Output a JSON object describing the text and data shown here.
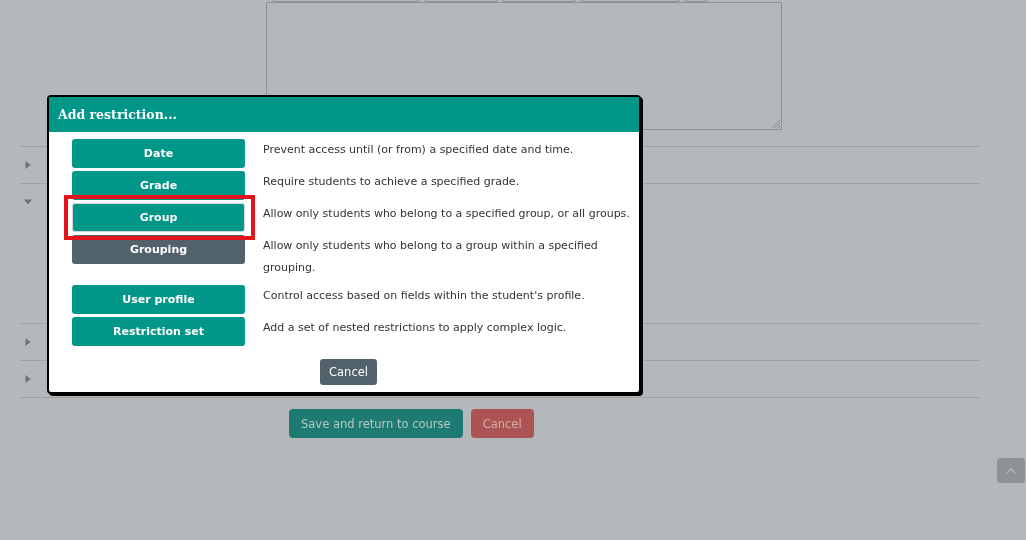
{
  "sections": [
    {
      "expanded": false
    },
    {
      "expanded": true
    },
    {
      "expanded": false
    },
    {
      "expanded": false
    }
  ],
  "form_buttons": [
    {
      "label": "Save and return to course",
      "kind": "primary"
    },
    {
      "label": "Cancel",
      "kind": "danger"
    }
  ],
  "dialog": {
    "title": "Add restriction...",
    "options": [
      {
        "label": "Date",
        "description": "Prevent access until (or from) a specified date and time.",
        "hovered": false,
        "highlighted": false
      },
      {
        "label": "Grade",
        "description": "Require students to achieve a specified grade.",
        "hovered": false,
        "highlighted": false
      },
      {
        "label": "Group",
        "description": "Allow only students who belong to a specified group, or all groups.",
        "hovered": false,
        "highlighted": true
      },
      {
        "label": "Grouping",
        "description": "Allow only students who belong to a group within a specified grouping.",
        "hovered": true,
        "highlighted": false
      },
      {
        "label": "User profile",
        "description": "Control access based on fields within the student's profile.",
        "hovered": false,
        "highlighted": false
      },
      {
        "label": "Restriction set",
        "description": "Add a set of nested restrictions to apply complex logic.",
        "hovered": false,
        "highlighted": false
      }
    ],
    "cancel": "Cancel"
  }
}
